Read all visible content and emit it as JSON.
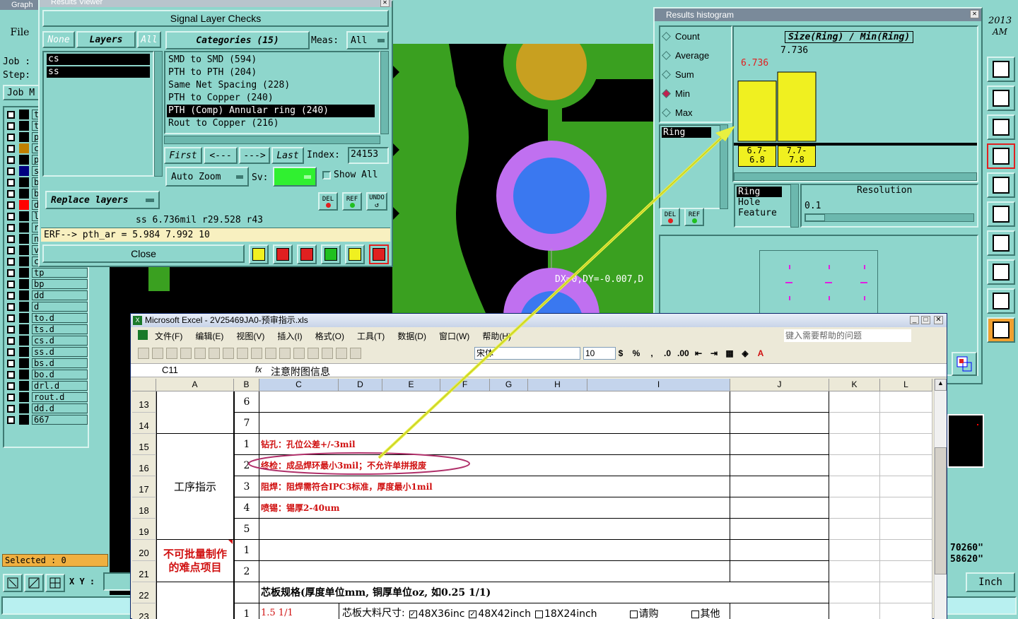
{
  "graphic": {
    "title": "Graph",
    "file_menu": "File",
    "job_label": "Job :",
    "step_label": "Step:",
    "job_mgr_btn": "Job M",
    "layers": [
      {
        "name": "tc",
        "color": "#000000"
      },
      {
        "name": "ts",
        "color": "#000000"
      },
      {
        "name": "pl",
        "color": "#000000"
      },
      {
        "name": "cs",
        "color": "#c08000"
      },
      {
        "name": "pl",
        "color": "#000000"
      },
      {
        "name": "ss",
        "color": "#000080"
      },
      {
        "name": "bs",
        "color": "#000000"
      },
      {
        "name": "bo",
        "color": "#000000"
      },
      {
        "name": "dr",
        "color": "#ff0000"
      },
      {
        "name": "lc",
        "color": "#000000"
      },
      {
        "name": "ro",
        "color": "#000000"
      },
      {
        "name": "np",
        "color": "#000000"
      },
      {
        "name": "v-cut",
        "color": "#000000"
      },
      {
        "name": "cvia",
        "color": "#000000"
      },
      {
        "name": "tp",
        "color": "#000000"
      },
      {
        "name": "bp",
        "color": "#000000"
      },
      {
        "name": "dd",
        "color": "#000000"
      },
      {
        "name": "d",
        "color": "#000000"
      },
      {
        "name": "to.d",
        "color": "#000000"
      },
      {
        "name": "ts.d",
        "color": "#000000"
      },
      {
        "name": "cs.d",
        "color": "#000000"
      },
      {
        "name": "ss.d",
        "color": "#000000"
      },
      {
        "name": "bs.d",
        "color": "#000000"
      },
      {
        "name": "bo.d",
        "color": "#000000"
      },
      {
        "name": "drl.d",
        "color": "#000000"
      },
      {
        "name": "rout.d",
        "color": "#000000"
      },
      {
        "name": "dd.d",
        "color": "#000000"
      },
      {
        "name": "667",
        "color": "#000000"
      }
    ],
    "selected": "Selected : 0",
    "xy_label": "X Y :",
    "year": "2013",
    "ampm": "AM",
    "coord1": "70260\"",
    "coord2": "58620\"",
    "units": "Inch",
    "measure_text": "DX=0,DY=-0.007,D"
  },
  "results_viewer": {
    "title": "Results Viewer",
    "header": "Signal Layer Checks",
    "none_btn": "None",
    "layers_btn": "Layers",
    "all_btn": "All",
    "layers": [
      "cs",
      "ss"
    ],
    "categories_btn": "Categories (15)",
    "meas_label": "Meas:",
    "meas_value": "All",
    "categories": [
      "SMD to SMD (594)",
      "PTH to PTH (204)",
      "Same Net Spacing (228)",
      "PTH to Copper (240)",
      "PTH (Comp) Annular ring (240)",
      "Rout to Copper (216)"
    ],
    "selected_category": 4,
    "first_btn": "First",
    "prev_btn": "<---",
    "next_btn": "--->",
    "last_btn": "Last",
    "index_label": "Index:",
    "index_value": "24153",
    "auto_zoom": "Auto Zoom",
    "sv_label": "Sv:",
    "show_all": "Show All",
    "replace_layers": "Replace layers",
    "del": "DEL",
    "ref": "REF",
    "undo": "UNDO",
    "status": "ss 6.736mil  r29.528  r43",
    "erf": "ERF--> pth_ar = 5.984 7.992 10",
    "close": "Close"
  },
  "histogram": {
    "title": "Results histogram",
    "modes": [
      "Count",
      "Average",
      "Sum",
      "Min",
      "Max"
    ],
    "selected_mode": 3,
    "list_top": "Ring",
    "chart_title": "Size(Ring) / Min(Ring)",
    "bars": [
      {
        "value_label": "6.736",
        "range_top": "6.7-",
        "range_bottom": "6.8",
        "value": 6.736
      },
      {
        "value_label": "7.736",
        "range_top": "7.7-",
        "range_bottom": "7.8",
        "value": 7.736
      }
    ],
    "del": "DEL",
    "ref": "REF",
    "attr_list": [
      "Ring",
      "Hole",
      "Feature"
    ],
    "resolution_label": "Resolution",
    "resolution_value": "0.1"
  },
  "chart_data": {
    "type": "bar",
    "title": "Size(Ring) / Min(Ring)",
    "categories": [
      "6.7-6.8",
      "7.7-7.8"
    ],
    "values": [
      6.736,
      7.736
    ]
  },
  "excel": {
    "title": "Microsoft Excel - 2V25469JA0-预审指示.xls",
    "menus": [
      "文件(F)",
      "编辑(E)",
      "视图(V)",
      "插入(I)",
      "格式(O)",
      "工具(T)",
      "数据(D)",
      "窗口(W)",
      "帮助(H)"
    ],
    "help_placeholder": "键入需要帮助的问题",
    "font_name": "宋体",
    "font_size": "10",
    "cell_ref": "C11",
    "fx": "fx",
    "formula": "注意附图信息",
    "columns": [
      "A",
      "B",
      "C",
      "D",
      "E",
      "F",
      "G",
      "H",
      "I",
      "J",
      "K",
      "L"
    ],
    "rows": [
      {
        "n": "13",
        "b": "6",
        "c": ""
      },
      {
        "n": "14",
        "b": "7",
        "c": ""
      },
      {
        "n": "15",
        "b": "1",
        "c": "钻孔：孔位公差+/-3mil"
      },
      {
        "n": "16",
        "b": "2",
        "c": "终检：成品焊环最小3mil；不允许单拼报废"
      },
      {
        "n": "17",
        "b": "3",
        "c": "阻焊：阻焊需符合IPC3标准，厚度最小1mil"
      },
      {
        "n": "18",
        "b": "4",
        "c": "喷锡：锡厚2-40um"
      },
      {
        "n": "19",
        "b": "5",
        "c": ""
      },
      {
        "n": "20",
        "b": "1",
        "c": ""
      },
      {
        "n": "21",
        "b": "2",
        "c": ""
      },
      {
        "n": "22",
        "b": "",
        "c": ""
      },
      {
        "n": "23",
        "b": "1",
        "c": ""
      }
    ],
    "group_a1": "工序指示",
    "group_a2": "不可批量制作的难点项目",
    "row22_text": "芯板规格(厚度单位mm, 铜厚单位oz, 如0.25 1/1)",
    "row23_c": "1.5 1/1",
    "row23_d": "芯板大料尺寸:",
    "row23_opts": [
      "48X36inc",
      "48X42inch",
      "18X24inch",
      "请购",
      "其他"
    ]
  }
}
